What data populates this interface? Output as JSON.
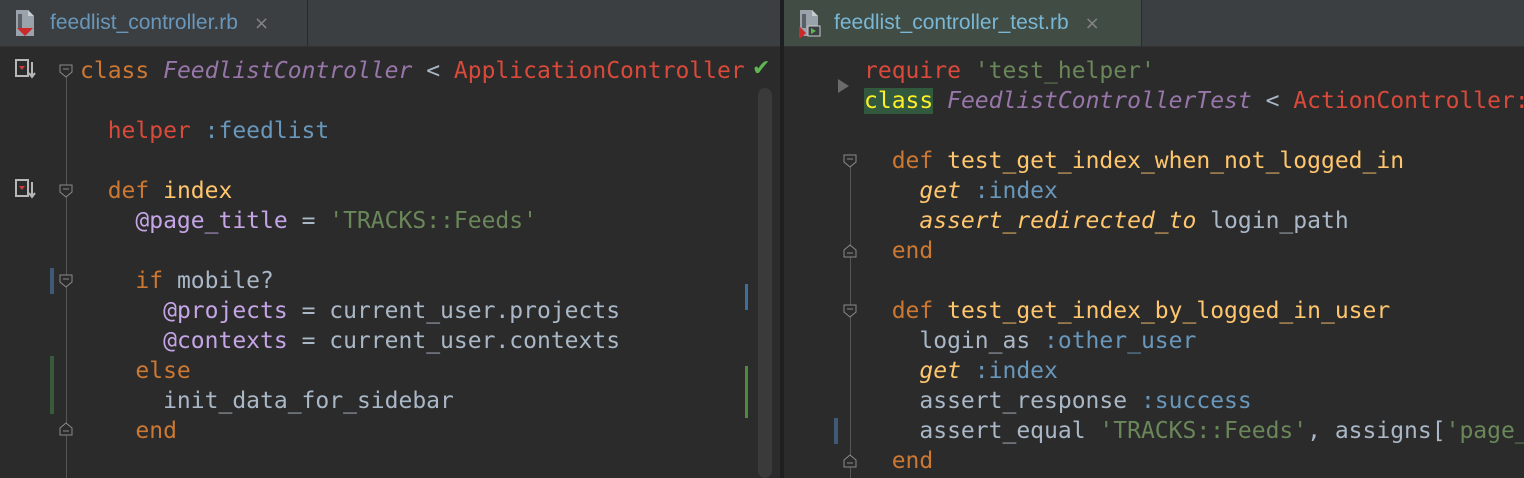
{
  "left": {
    "tab": {
      "label": "feedlist_controller.rb",
      "close": "×"
    },
    "lines": [
      [
        [
          "kw",
          "class "
        ],
        [
          "cls",
          "FeedlistController"
        ],
        [
          "ctx",
          " < "
        ],
        [
          "sup",
          "ApplicationController"
        ]
      ],
      [],
      [
        [
          "sup",
          "  helper "
        ],
        [
          "sym",
          ":feedlist"
        ]
      ],
      [],
      [
        [
          "kw",
          "  def "
        ],
        [
          "meth",
          "index"
        ]
      ],
      [
        [
          "ctx",
          "    "
        ],
        [
          "ivar",
          "@page_title"
        ],
        [
          "ctx",
          " = "
        ],
        [
          "str",
          "'TRACKS::Feeds'"
        ]
      ],
      [],
      [
        [
          "kw",
          "    if "
        ],
        [
          "ctx",
          "mobile?"
        ]
      ],
      [
        [
          "ctx",
          "      "
        ],
        [
          "ivar",
          "@projects"
        ],
        [
          "ctx",
          " = current_user.projects"
        ]
      ],
      [
        [
          "ctx",
          "      "
        ],
        [
          "ivar",
          "@contexts"
        ],
        [
          "ctx",
          " = current_user.contexts"
        ]
      ],
      [
        [
          "kw",
          "    else"
        ]
      ],
      [
        [
          "ctx",
          "      init_data_for_sidebar"
        ]
      ],
      [
        [
          "kw",
          "    end"
        ]
      ]
    ],
    "check": "✔"
  },
  "right": {
    "tab": {
      "label": "feedlist_controller_test.rb",
      "close": "×"
    },
    "lines": [
      [
        [
          "sup",
          "require "
        ],
        [
          "str",
          "'test_helper'"
        ]
      ],
      [
        [
          "hl",
          "class"
        ],
        [
          "ctx",
          " "
        ],
        [
          "cls",
          "FeedlistControllerTest"
        ],
        [
          "ctx",
          " < "
        ],
        [
          "sup",
          "ActionController::TestCase"
        ]
      ],
      [],
      [
        [
          "kw",
          "  def "
        ],
        [
          "meth",
          "test_get_index_when_not_logged_in"
        ]
      ],
      [
        [
          "ctx",
          "    "
        ],
        [
          "call",
          "get"
        ],
        [
          "ctx",
          " "
        ],
        [
          "sym",
          ":index"
        ]
      ],
      [
        [
          "ctx",
          "    "
        ],
        [
          "call",
          "assert_redirected_to"
        ],
        [
          "ctx",
          " login_path"
        ]
      ],
      [
        [
          "kw",
          "  end"
        ]
      ],
      [],
      [
        [
          "kw",
          "  def "
        ],
        [
          "meth",
          "test_get_index_by_logged_in_user"
        ]
      ],
      [
        [
          "ctx",
          "    login_as "
        ],
        [
          "sym",
          ":other_user"
        ]
      ],
      [
        [
          "ctx",
          "    "
        ],
        [
          "call",
          "get"
        ],
        [
          "ctx",
          " "
        ],
        [
          "sym",
          ":index"
        ]
      ],
      [
        [
          "ctx",
          "    assert_response "
        ],
        [
          "sym",
          ":success"
        ]
      ],
      [
        [
          "ctx",
          "    assert_equal "
        ],
        [
          "str",
          "'TRACKS::Feeds'"
        ],
        [
          "ctx",
          ", assigns["
        ],
        [
          "str",
          "'page_title'"
        ],
        [
          "ctx",
          "]"
        ]
      ],
      [
        [
          "kw",
          "  end"
        ]
      ]
    ]
  },
  "colors": {
    "background": "#2b2b2b",
    "keyword": "#cc7832",
    "class_name": "#9876aa",
    "superclass": "#da4a3a",
    "symbol": "#6897bb",
    "string": "#6a8759",
    "ivar": "#c5a5e6",
    "method": "#ffc66d",
    "highlight_bg": "#32593d",
    "highlight_fg": "#ffef28"
  }
}
